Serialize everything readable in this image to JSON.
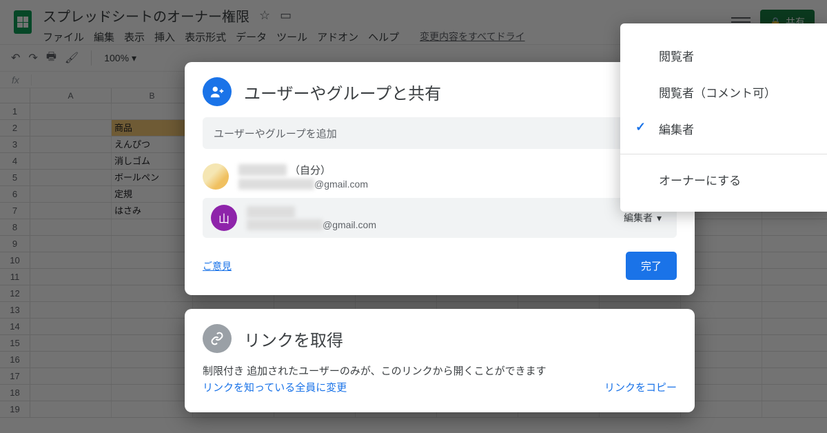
{
  "doc": {
    "title": "スプレッドシートのオーナー権限"
  },
  "menu": {
    "file": "ファイル",
    "edit": "編集",
    "view": "表示",
    "insert": "挿入",
    "format": "表示形式",
    "data": "データ",
    "tools": "ツール",
    "addons": "アドオン",
    "help": "ヘルプ",
    "status": "変更内容をすべてドライ"
  },
  "toolbar": {
    "zoom": "100%",
    "share": "共有"
  },
  "cols": {
    "A": "A",
    "B": "B"
  },
  "rows": {
    "2": {
      "B": "商品"
    },
    "3": {
      "B": "えんぴつ"
    },
    "4": {
      "B": "消しゴム"
    },
    "5": {
      "B": "ボールペン"
    },
    "6": {
      "B": "定規"
    },
    "7": {
      "B": "はさみ"
    }
  },
  "share": {
    "title": "ユーザーやグループと共有",
    "placeholder": "ユーザーやグループを追加",
    "people": [
      {
        "self_suffix": "（自分）",
        "email_domain": "@gmail.com"
      },
      {
        "avatar_letter": "山",
        "email_domain": "@gmail.com",
        "role": "編集者"
      }
    ],
    "feedback": "ご意見",
    "done": "完了"
  },
  "link": {
    "title": "リンクを取得",
    "desc": "制限付き 追加されたユーザーのみが、このリンクから開くことができます",
    "change": "リンクを知っている全員に変更",
    "copy": "リンクをコピー"
  },
  "popup": {
    "viewer": "閲覧者",
    "commenter": "閲覧者（コメント可）",
    "editor": "編集者",
    "make_owner": "オーナーにする"
  }
}
